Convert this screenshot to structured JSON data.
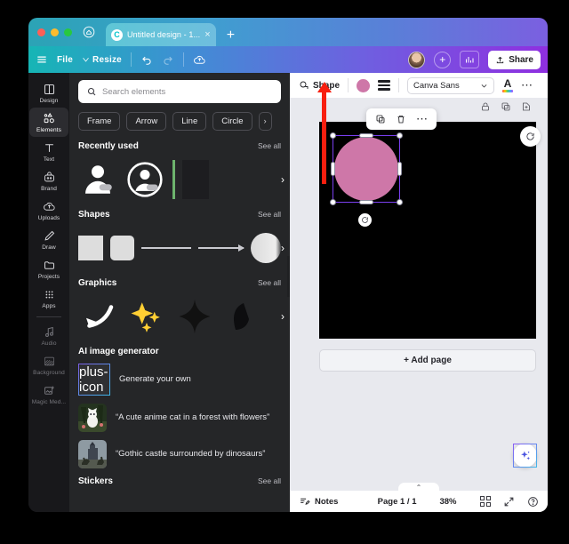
{
  "browser": {
    "traffic_lights": [
      "close",
      "minimize",
      "maximize"
    ],
    "home_icon": "home-icon",
    "tab": {
      "title": "Untitled design - 1...",
      "favicon_letter": "C",
      "close": "×"
    },
    "new_tab": "+"
  },
  "appbar": {
    "menu_icon": "hamburger-icon",
    "file_label": "File",
    "resize_label": "Resize",
    "undo_icon": "undo-icon",
    "redo_icon": "redo-icon",
    "cloud_icon": "cloud-save-icon",
    "plus_label": "+",
    "chart_icon": "bar-chart-icon",
    "share_label": "Share",
    "share_icon": "upload-icon"
  },
  "rail": {
    "items": [
      {
        "label": "Design",
        "icon": "layout-icon",
        "active": false
      },
      {
        "label": "Elements",
        "icon": "shapes-icon",
        "active": true
      },
      {
        "label": "Text",
        "icon": "text-t-icon",
        "active": false
      },
      {
        "label": "Brand",
        "icon": "brand-icon",
        "active": false
      },
      {
        "label": "Uploads",
        "icon": "cloud-upload-icon",
        "active": false
      },
      {
        "label": "Draw",
        "icon": "pen-icon",
        "active": false
      },
      {
        "label": "Projects",
        "icon": "folder-icon",
        "active": false
      },
      {
        "label": "Apps",
        "icon": "grid-dots-icon",
        "active": false
      },
      {
        "label": "Audio",
        "icon": "music-note-icon",
        "active": false
      },
      {
        "label": "Background",
        "icon": "background-icon",
        "active": false
      },
      {
        "label": "Magic Med...",
        "icon": "magic-media-icon",
        "active": false
      }
    ]
  },
  "panel": {
    "search": {
      "placeholder": "Search elements",
      "icon": "search-icon"
    },
    "chips": [
      "Frame",
      "Arrow",
      "Line",
      "Circle"
    ],
    "chip_next": "›",
    "sections": {
      "recently_used": {
        "title": "Recently used",
        "see_all": "See all"
      },
      "shapes": {
        "title": "Shapes",
        "see_all": "See all"
      },
      "graphics": {
        "title": "Graphics",
        "see_all": "See all"
      },
      "stickers": {
        "title": "Stickers",
        "see_all": "See all"
      }
    },
    "ai": {
      "title": "AI image generator",
      "generate_label": "Generate your own",
      "generate_icon": "plus-icon",
      "prompts": [
        "“A cute anime cat in a forest with flowers”",
        "“Gothic castle surrounded by dinosaurs”"
      ]
    },
    "collapse_icon": "chevron-left-icon"
  },
  "toolbar": {
    "shape_label": "Shape",
    "shape_icon": "shape-icon",
    "color_swatch": "#ce77a8",
    "lines_icon": "line-style-icon",
    "font_name": "Canva Sans",
    "font_chevron": "⌄",
    "text_color_icon": "text-color-A-icon",
    "more_icon": "more-horizontal-icon"
  },
  "canvas": {
    "page_icons": [
      "lock-icon",
      "duplicate-page-icon",
      "add-page-icon"
    ],
    "background_color": "#000000",
    "shape": {
      "name": "circle",
      "fill": "#ce77a8",
      "selected": true
    },
    "float_toolbar": [
      "duplicate-icon",
      "trash-icon",
      "more-horizontal-icon"
    ],
    "rotate_icon": "rotate-icon",
    "reload_icon": "reload-icon",
    "add_page_label": "+ Add page",
    "magic_icon": "magic-sparkle-icon"
  },
  "statusbar": {
    "notes_label": "Notes",
    "notes_icon": "notes-icon",
    "page_label": "Page 1 / 1",
    "zoom_label": "38%",
    "grid_icon": "grid-view-icon",
    "fullscreen_icon": "fullscreen-icon",
    "help_icon": "help-icon",
    "collapse_caret": "⌃"
  },
  "annotation": {
    "type": "arrow",
    "color": "#f81f0f",
    "points_to": "color-swatch"
  }
}
